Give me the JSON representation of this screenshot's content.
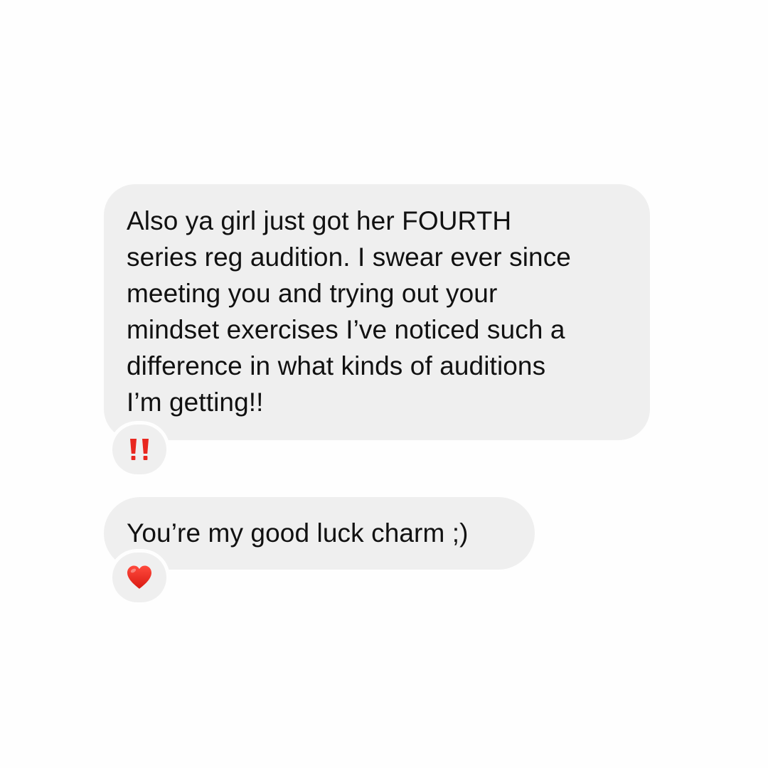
{
  "messages": [
    {
      "lines": [
        "Also ya girl just got her FOURTH",
        "series reg audition. I swear ever since",
        "meeting you and trying out your",
        "mindset exercises I’ve noticed such a",
        "difference in what kinds of auditions",
        "I’m getting!!"
      ],
      "reaction": {
        "icon": "double-exclamation-icon",
        "color": "#e8271f"
      }
    },
    {
      "lines": [
        "You’re my good luck charm ;)"
      ],
      "reaction": {
        "icon": "red-heart-icon",
        "color": "#e8271f"
      }
    }
  ],
  "colors": {
    "background": "#fefefe",
    "bubble": "#efefef",
    "text": "#111111",
    "reaction_red": "#e8271f"
  }
}
